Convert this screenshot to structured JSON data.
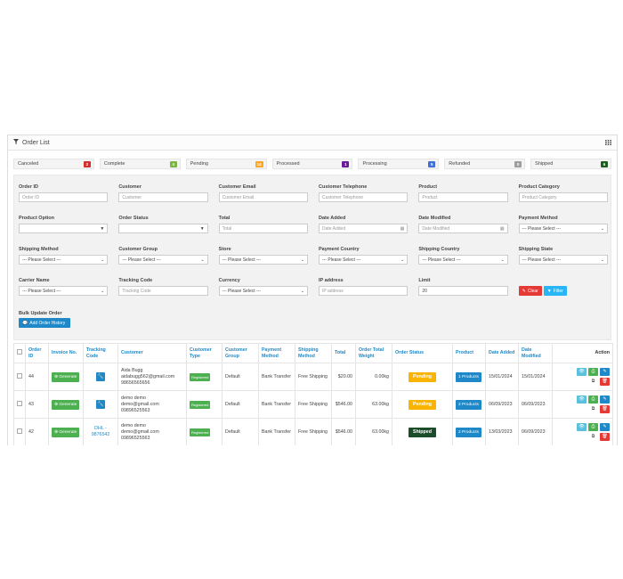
{
  "panel": {
    "title": "Order List",
    "filter_icon": "filter-icon",
    "grid_icon": "grid-icon"
  },
  "statuses": [
    {
      "label": "Canceled",
      "count": "2",
      "color": "#d32f2f"
    },
    {
      "label": "Complete",
      "count": "4",
      "color": "#7cb342"
    },
    {
      "label": "Pending",
      "count": "14",
      "color": "#f9a825"
    },
    {
      "label": "Processed",
      "count": "1",
      "color": "#6a1b9a"
    },
    {
      "label": "Processing",
      "count": "5",
      "color": "#3f6fd8"
    },
    {
      "label": "Refunded",
      "count": "0",
      "color": "#9e9e9e"
    },
    {
      "label": "Shipped",
      "count": "6",
      "color": "#1b5e20"
    }
  ],
  "filters": {
    "row1": [
      {
        "label": "Order ID",
        "placeholder": "Order ID"
      },
      {
        "label": "Customer",
        "placeholder": "Customer"
      },
      {
        "label": "Customer Email",
        "placeholder": "Customer Email"
      },
      {
        "label": "Customer Telephone",
        "placeholder": "Customer Telephone"
      },
      {
        "label": "Product",
        "placeholder": "Product"
      },
      {
        "label": "Product Category",
        "placeholder": "Product Category"
      }
    ],
    "row2": [
      {
        "label": "Product Option",
        "value": ""
      },
      {
        "label": "Order Status",
        "value": ""
      },
      {
        "label": "Total",
        "placeholder": "Total"
      },
      {
        "label": "Date Added",
        "placeholder": "Date Added"
      },
      {
        "label": "Date Modified",
        "placeholder": "Date Modified"
      },
      {
        "label": "Payment Method",
        "value": "--- Please Select ---"
      }
    ],
    "row3": [
      {
        "label": "Shipping Method",
        "value": "--- Please Select ---"
      },
      {
        "label": "Customer Group",
        "value": "--- Please Select ---"
      },
      {
        "label": "Store",
        "value": "--- Please Select ---"
      },
      {
        "label": "Payment Country",
        "value": "--- Please Select ---"
      },
      {
        "label": "Shipping Country",
        "value": "--- Please Select ---"
      },
      {
        "label": "Shipping State",
        "value": "--- Please Select ---"
      }
    ],
    "row4": [
      {
        "label": "Carrier Name",
        "value": "--- Please Select ---"
      },
      {
        "label": "Tracking Code",
        "placeholder": "Tracking Code"
      },
      {
        "label": "Currency",
        "value": "--- Please Select ---"
      },
      {
        "label": "IP address",
        "placeholder": "IP address"
      },
      {
        "label": "Limit",
        "value": "20"
      }
    ],
    "clear_label": "Clear",
    "filter_label": "Filter",
    "bulk_label": "Bulk Update Order",
    "add_history_label": "Add Order History"
  },
  "table": {
    "headers": [
      "Order ID",
      "Invoice No.",
      "Tracking Code",
      "Customer",
      "Customer Type",
      "Customer Group",
      "Payment Method",
      "Shipping Method",
      "Total",
      "Order Total Weight",
      "Order Status",
      "Product",
      "Date Added",
      "Date Modified",
      "Action"
    ],
    "rows": [
      {
        "id": "44",
        "invoice": "Generate",
        "tracking": "",
        "customer_name": "Aida Bugg",
        "customer_email": "aidabugg562@gmail.com",
        "customer_phone": "98656565656",
        "type": "Registered",
        "group": "Default",
        "payment": "Bank Transfer",
        "shipping": "Free Shipping",
        "total": "$20.00",
        "weight": "0.00kg",
        "status": "Pending",
        "status_color": "#f9b400",
        "product": "1 Products",
        "date_added": "15/01/2024",
        "date_modified": "15/01/2024"
      },
      {
        "id": "43",
        "invoice": "Generate",
        "tracking": "",
        "customer_name": "demo demo",
        "customer_email": "demo@gmail.com",
        "customer_phone": "09896525563",
        "type": "Registered",
        "group": "Default",
        "payment": "Bank Transfer",
        "shipping": "Free Shipping",
        "total": "$546.00",
        "weight": "63.00kg",
        "status": "Pending",
        "status_color": "#f9b400",
        "product": "2 Products",
        "date_added": "06/09/2023",
        "date_modified": "06/09/2023"
      },
      {
        "id": "42",
        "invoice": "Generate",
        "tracking": "DHL - 9876542",
        "customer_name": "demo demo",
        "customer_email": "demo@gmail.com",
        "customer_phone": "09896525563",
        "type": "Registered",
        "group": "Default",
        "payment": "Bank Transfer",
        "shipping": "Free Shipping",
        "total": "$546.00",
        "weight": "63.00kg",
        "status": "Shipped",
        "status_color": "#1b4d2a",
        "product": "2 Products",
        "date_added": "13/03/2023",
        "date_modified": "06/09/2023"
      }
    ]
  }
}
